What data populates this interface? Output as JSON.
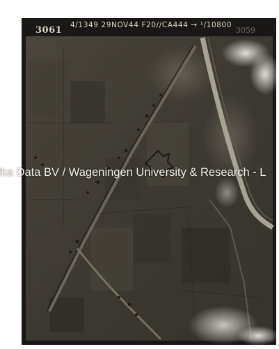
{
  "photo": {
    "frame_number": "3061",
    "caption": "4/1349   29NOV44   F20//CA444 → ¹/10800",
    "frame_number_faint": "3059"
  },
  "watermark": {
    "text": "tka Data BV / Wageningen University & Research - L"
  },
  "colors": {
    "print_border": "#1d1b18",
    "page_background": "#ffffff",
    "caption_text": "#ddd6c8"
  }
}
